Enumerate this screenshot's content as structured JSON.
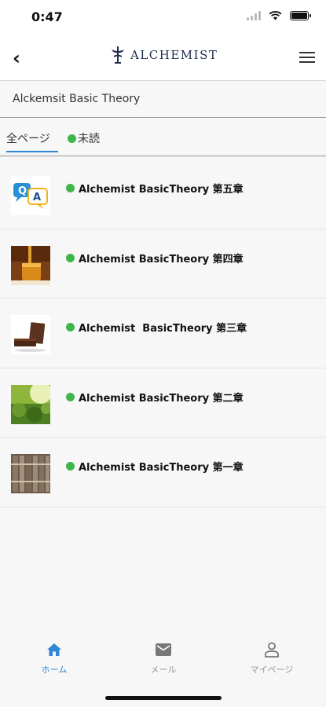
{
  "status_bar": {
    "time": "0:47"
  },
  "header": {
    "logo_text": "ALCHEMIST"
  },
  "section": {
    "title": "Alckemsit Basic Theory"
  },
  "tabs": {
    "all": "全ページ",
    "unread": "未読"
  },
  "items": [
    {
      "title": "Alchemist BasicTheory 第五章",
      "thumb": "qa-icon"
    },
    {
      "title": "Alchemist BasicTheory 第四章",
      "thumb": "honey-jar-photo"
    },
    {
      "title": "Alchemist  BasicTheory 第三章",
      "thumb": "chocolate-photo"
    },
    {
      "title": "Alchemist BasicTheory 第二章",
      "thumb": "green-field-photo"
    },
    {
      "title": "Alchemist BasicTheory 第一章",
      "thumb": "old-books-photo"
    }
  ],
  "nav": {
    "home": "ホーム",
    "mail": "メール",
    "mypage": "マイページ"
  },
  "colors": {
    "accent": "#2f86d4",
    "unread_dot": "#3fb64a",
    "logo": "#1f2d4e"
  }
}
